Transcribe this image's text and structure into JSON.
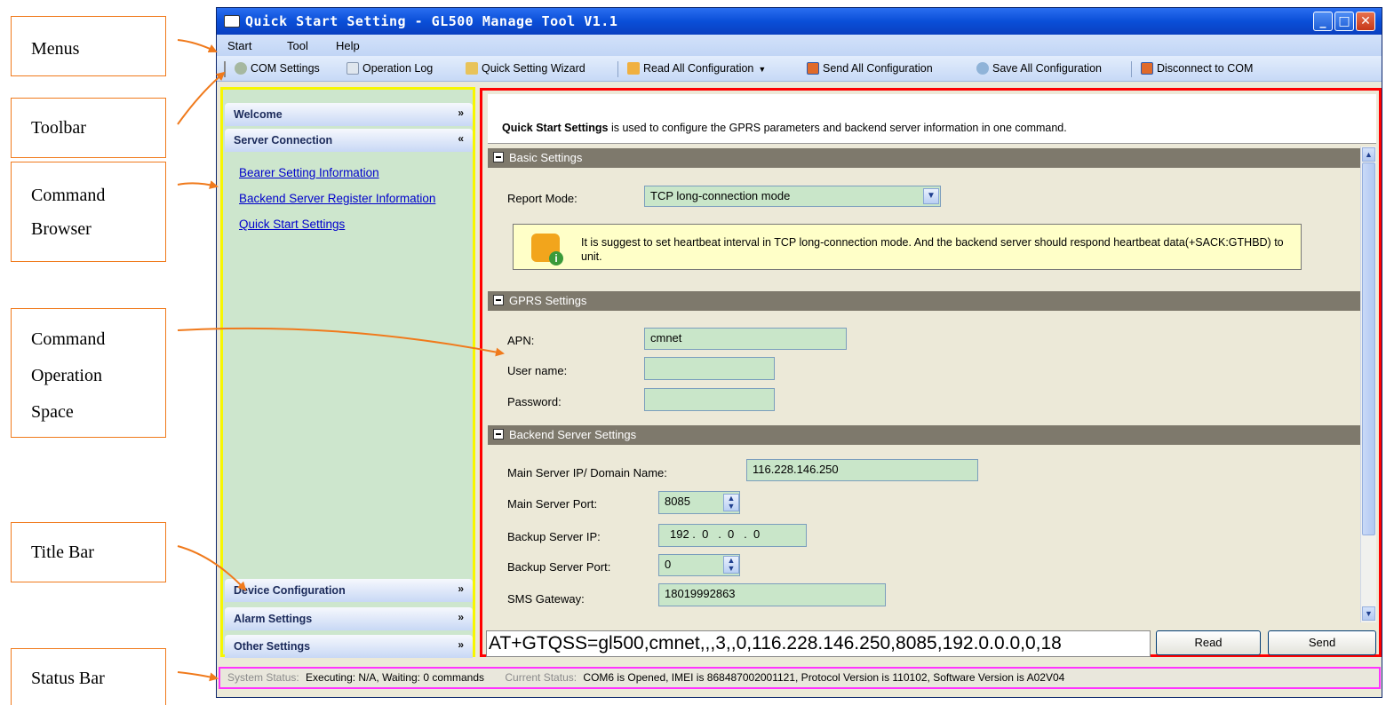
{
  "callouts": {
    "menus": "Menus",
    "toolbar": "Toolbar",
    "command_browser_1": "Command",
    "command_browser_2": "Browser",
    "command_op_1": "Command",
    "command_op_2": "Operation",
    "command_op_3": "Space",
    "title_bar": "Title Bar",
    "status_bar": "Status Bar"
  },
  "window": {
    "title": "Quick Start Setting - GL500 Manage Tool V1.1",
    "minimize": "_",
    "maximize": "□",
    "close": "✕"
  },
  "menu": {
    "start": "Start",
    "tool": "Tool",
    "help": "Help"
  },
  "toolbar": {
    "com_settings": "COM Settings",
    "operation_log": "Operation Log",
    "quick_wizard": "Quick Setting Wizard",
    "read_all": "Read All Configuration",
    "send_all": "Send All Configuration",
    "save_all": "Save All Configuration",
    "disconnect": "Disconnect to COM"
  },
  "sidebar": {
    "welcome": "Welcome",
    "server_connection": "Server Connection",
    "links": [
      "Bearer Setting Information",
      "Backend Server Register Information",
      "Quick Start Settings"
    ],
    "device_configuration": "Device Configuration",
    "alarm_settings": "Alarm Settings",
    "other_settings": "Other Settings"
  },
  "content": {
    "intro_bold": "Quick Start Settings",
    "intro_rest": " is used to configure the GPRS parameters and backend server information in one command.",
    "basic_settings": "Basic Settings",
    "report_mode_label": "Report Mode:",
    "report_mode_value": "TCP long-connection mode",
    "notice_text": "It is suggest to set heartbeat interval in TCP long-connection mode. And the backend server should respond heartbeat data(+SACK:GTHBD) to unit.",
    "gprs_settings": "GPRS Settings",
    "apn_label": "APN:",
    "apn_value": "cmnet",
    "username_label": "User name:",
    "username_value": "",
    "password_label": "Password:",
    "password_value": "",
    "backend_settings": "Backend Server Settings",
    "main_ip_label": "Main Server IP/ Domain Name:",
    "main_ip_value": "116.228.146.250",
    "main_port_label": "Main Server Port:",
    "main_port_value": "8085",
    "backup_ip_label": "Backup Server IP:",
    "backup_ip_value": "192 .  0   .  0   .  0",
    "backup_port_label": "Backup Server Port:",
    "backup_port_value": "0",
    "sms_label": "SMS Gateway:",
    "sms_value": "18019992863",
    "command_string": "AT+GTQSS=gl500,cmnet,,,3,,0,116.228.146.250,8085,192.0.0.0,0,18",
    "read_button": "Read",
    "send_button": "Send"
  },
  "status": {
    "system_label": "System Status:",
    "system_value": "Executing: N/A, Waiting: 0 commands",
    "current_label": "Current Status:",
    "current_value": "COM6 is Opened, IMEI is 868487002001121, Protocol Version is 110102, Software Version is A02V04"
  },
  "colors": {
    "left_panel_border": "#f7f700",
    "right_panel_border": "#ff0000",
    "status_border": "#ff33ff",
    "callout_border": "#f07a1c",
    "field_bg": "#c9e6c9"
  }
}
